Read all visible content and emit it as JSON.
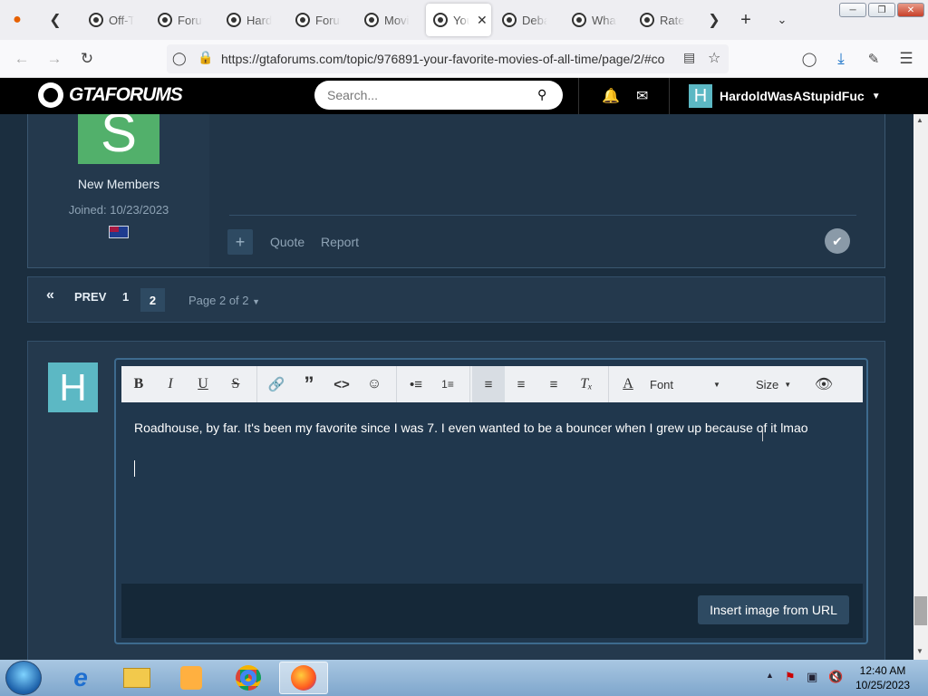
{
  "browser": {
    "tabs": [
      {
        "label": "Off-To"
      },
      {
        "label": "Forum"
      },
      {
        "label": "Hardo"
      },
      {
        "label": "Forum"
      },
      {
        "label": "Movie"
      },
      {
        "label": "You",
        "active": true
      },
      {
        "label": "Debat"
      },
      {
        "label": "What"
      },
      {
        "label": "Rate T"
      }
    ],
    "url": "https://gtaforums.com/topic/976891-your-favorite-movies-of-all-time/page/2/#co"
  },
  "site": {
    "logo_text": "GTAFORUMS",
    "search_placeholder": "Search...",
    "username": "HardoldWasAStupidFuc",
    "user_initial": "H"
  },
  "post": {
    "author_initial": "S",
    "author_group": "New Members",
    "joined": "Joined: 10/23/2023",
    "actions": {
      "plus": "+",
      "quote": "Quote",
      "report": "Report"
    }
  },
  "pagination": {
    "first": "«",
    "prev": "PREV",
    "pages": [
      "1",
      "2"
    ],
    "current": "2",
    "page_of": "Page 2 of 2"
  },
  "editor": {
    "user_initial": "H",
    "toolbar": {
      "font": "Font",
      "size": "Size"
    },
    "text": "Roadhouse, by far. It's been my favorite since I was 7. I even wanted to be a bouncer when I grew up because of it lmao",
    "insert_image_label": "Insert image from URL"
  },
  "taskbar": {
    "time": "12:40 AM",
    "date": "10/25/2023"
  },
  "colors": {
    "page_bg": "#1b2e3f",
    "panel": "#24394d",
    "accent": "#5cb8c4",
    "author_avatar": "#52b06b"
  }
}
